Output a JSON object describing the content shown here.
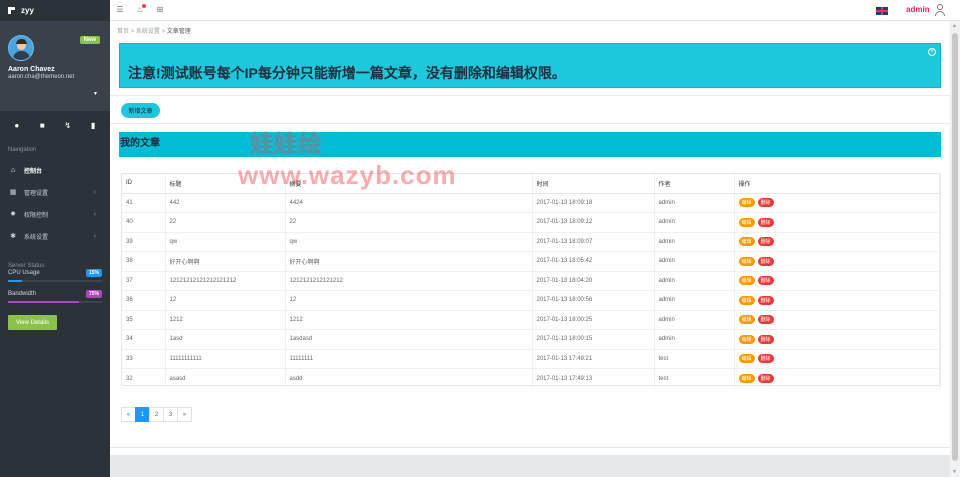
{
  "brand": {
    "name": "zyy"
  },
  "profile": {
    "badge": "New",
    "name": "Aaron Chavez",
    "email": "aaron.cha@themeon.net"
  },
  "sidebar": {
    "nav_title": "Navigation",
    "items": [
      {
        "label": "控制台",
        "icon": "home-icon"
      },
      {
        "label": "管理设置",
        "icon": "grid-icon"
      },
      {
        "label": "权限控制",
        "icon": "gear-icon"
      },
      {
        "label": "系统设置",
        "icon": "cog-icon"
      }
    ],
    "status_title": "Server Status",
    "cpu": {
      "label": "CPU Usage",
      "value": "15%",
      "percent": 15,
      "color": "#2196f3"
    },
    "bandwidth": {
      "label": "Bandwidth",
      "value": "75%",
      "percent": 75,
      "color": "#ab47bc"
    },
    "view_details": "View Details"
  },
  "topbar": {
    "user_label": "admin"
  },
  "breadcrumb": {
    "home": "首页",
    "sep": ">",
    "section": "系统设置",
    "current": "文章管理"
  },
  "alert": {
    "text": "注意!测试账号每个IP每分钟只能新增一篇文章，没有删除和编辑权限。"
  },
  "actions": {
    "add_label": "新增文章"
  },
  "section": {
    "title": "我的文章"
  },
  "watermark": {
    "url": "www.wazyb.com",
    "cn": "娃娃绘"
  },
  "table": {
    "headers": [
      "ID",
      "标题",
      "摘要",
      "时间",
      "作者",
      "操作"
    ],
    "edit_label": "编辑",
    "delete_label": "删除",
    "rows": [
      [
        "41",
        "442",
        "4424",
        "2017-01-13 18:09:18",
        "admin"
      ],
      [
        "40",
        "22",
        "22",
        "2017-01-13 18:09:12",
        "admin"
      ],
      [
        "39",
        "qw",
        "qw",
        "2017-01-13 18:09:07",
        "admin"
      ],
      [
        "38",
        "好开心啊啊",
        "好开心啊啊",
        "2017-01-13 18:05:42",
        "admin"
      ],
      [
        "37",
        "12121212121212121212",
        "1212121212121212",
        "2017-01-13 18:04:20",
        "admin"
      ],
      [
        "36",
        "12",
        "12",
        "2017-01-13 18:00:56",
        "admin"
      ],
      [
        "35",
        "1212",
        "1212",
        "2017-01-13 18:00:25",
        "admin"
      ],
      [
        "34",
        "1asd",
        "1asdasd",
        "2017-01-13 18:00:15",
        "admin"
      ],
      [
        "33",
        "11111111111",
        "11111111",
        "2017-01-13 17:49:21",
        "test"
      ],
      [
        "32",
        "asasd",
        "asdd",
        "2017-01-13 17:49:13",
        "test"
      ]
    ]
  },
  "pagination": {
    "prev": "«",
    "pages": [
      "1",
      "2",
      "3"
    ],
    "next": "»"
  }
}
